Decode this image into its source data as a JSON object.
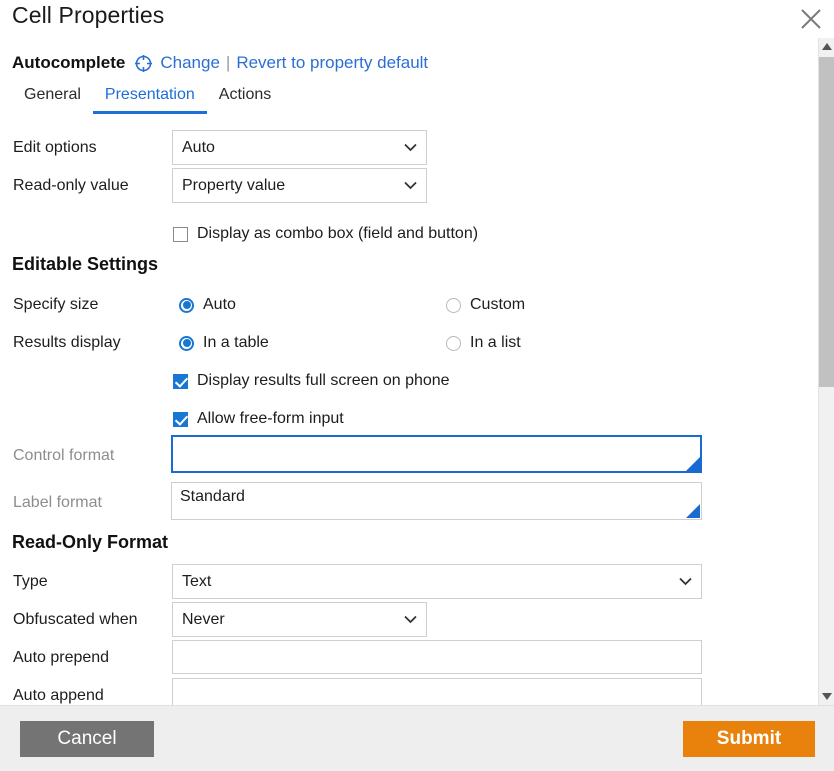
{
  "dialog": {
    "title": "Cell Properties",
    "close_icon": "close-x-icon"
  },
  "property_header": {
    "name": "Autocomplete",
    "target_icon": "crosshair-target-icon",
    "change_link": "Change",
    "separator": "|",
    "revert_link": "Revert to property default"
  },
  "tabs": [
    {
      "label": "General",
      "active": false
    },
    {
      "label": "Presentation",
      "active": true
    },
    {
      "label": "Actions",
      "active": false
    }
  ],
  "form": {
    "edit_options": {
      "label": "Edit options",
      "value": "Auto",
      "options": [
        "Auto"
      ]
    },
    "read_only_value": {
      "label": "Read-only value",
      "value": "Property value",
      "options": [
        "Property value"
      ]
    },
    "combo_box": {
      "label": "Display as combo box (field and button)",
      "checked": false
    }
  },
  "editable_settings": {
    "heading": "Editable Settings",
    "specify_size": {
      "label": "Specify size",
      "options": [
        {
          "label": "Auto",
          "selected": true
        },
        {
          "label": "Custom",
          "selected": false
        }
      ]
    },
    "results_display": {
      "label": "Results display",
      "options": [
        {
          "label": "In a table",
          "selected": true
        },
        {
          "label": "In a list",
          "selected": false
        }
      ]
    },
    "full_screen_phone": {
      "label": "Display results full screen on phone",
      "checked": true
    },
    "free_form_input": {
      "label": "Allow free-form input",
      "checked": true
    },
    "control_format": {
      "label": "Control format",
      "value": "",
      "focused": true
    },
    "label_format": {
      "label": "Label format",
      "value": "Standard",
      "focused": false
    }
  },
  "read_only_format": {
    "heading": "Read-Only Format",
    "type": {
      "label": "Type",
      "value": "Text",
      "options": [
        "Text"
      ]
    },
    "obfuscated_when": {
      "label": "Obfuscated when",
      "value": "Never",
      "options": [
        "Never"
      ]
    },
    "auto_prepend": {
      "label": "Auto prepend",
      "value": ""
    },
    "auto_append": {
      "label": "Auto append",
      "value": ""
    }
  },
  "scrollbar": {
    "up_icon": "scroll-up-arrow-icon",
    "down_icon": "scroll-down-arrow-icon"
  },
  "footer": {
    "cancel_label": "Cancel",
    "submit_label": "Submit"
  },
  "colors": {
    "accent_blue": "#1c6fd8",
    "link_blue": "#2b6fd4",
    "submit_orange": "#e8820c",
    "cancel_gray": "#747474",
    "footer_bg": "#eeeeee"
  }
}
